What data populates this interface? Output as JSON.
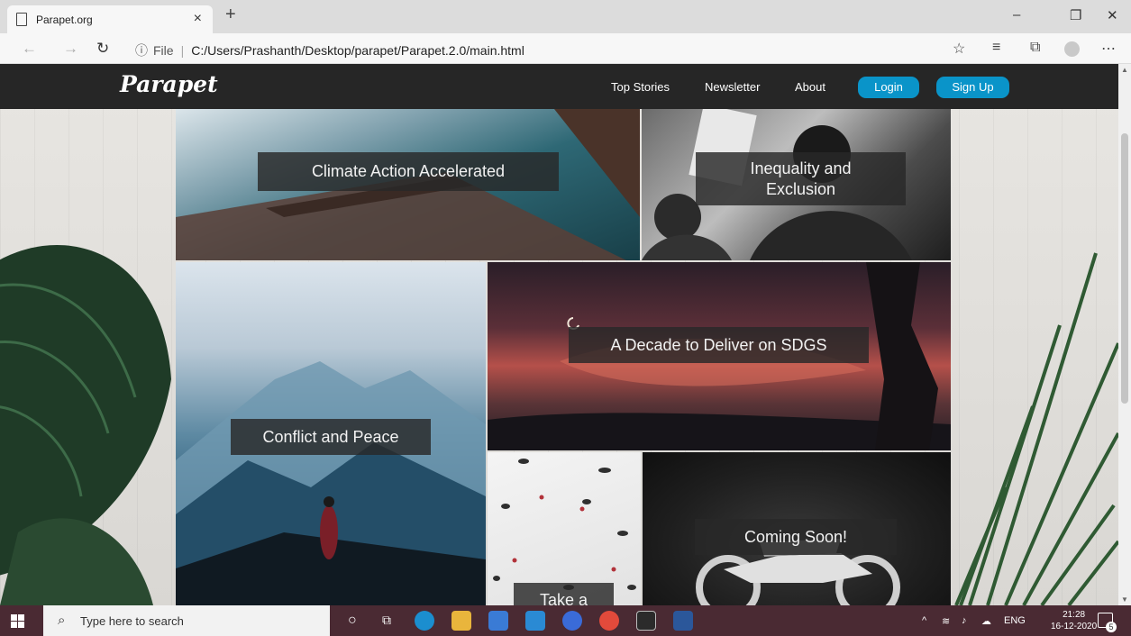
{
  "browser": {
    "tab_title": "Parapet.org",
    "tab_close": "×",
    "new_tab": "+",
    "url_info": "ⓘ",
    "url_scheme": "File",
    "url_path": "C:/Users/Prashanth/Desktop/parapet/Parapet.2.0/main.html",
    "window_controls": [
      "–",
      "❐",
      "✕"
    ]
  },
  "site": {
    "logo": "Parapet",
    "nav_links": [
      "Top Stories",
      "Newsletter",
      "About"
    ],
    "login_label": "Login",
    "signup_label": "Sign Up",
    "accent_color": "#0a94c9",
    "nav_bg": "#262626"
  },
  "tiles": [
    {
      "id": "climate",
      "label": "Climate Action Accelerated"
    },
    {
      "id": "inequality",
      "label": "Inequality and Exclusion"
    },
    {
      "id": "conflict",
      "label": "Conflict and Peace"
    },
    {
      "id": "decade",
      "label": "A Decade to Deliver on SDGS"
    },
    {
      "id": "survey",
      "label": "Take a Survey!"
    },
    {
      "id": "coming",
      "label": "Coming Soon!"
    }
  ],
  "taskbar": {
    "search_placeholder": "Type here to search",
    "language": "ENG",
    "time": "21:28",
    "date": "16-12-2020",
    "notification_count": "5",
    "bg": "#4a2a33"
  }
}
